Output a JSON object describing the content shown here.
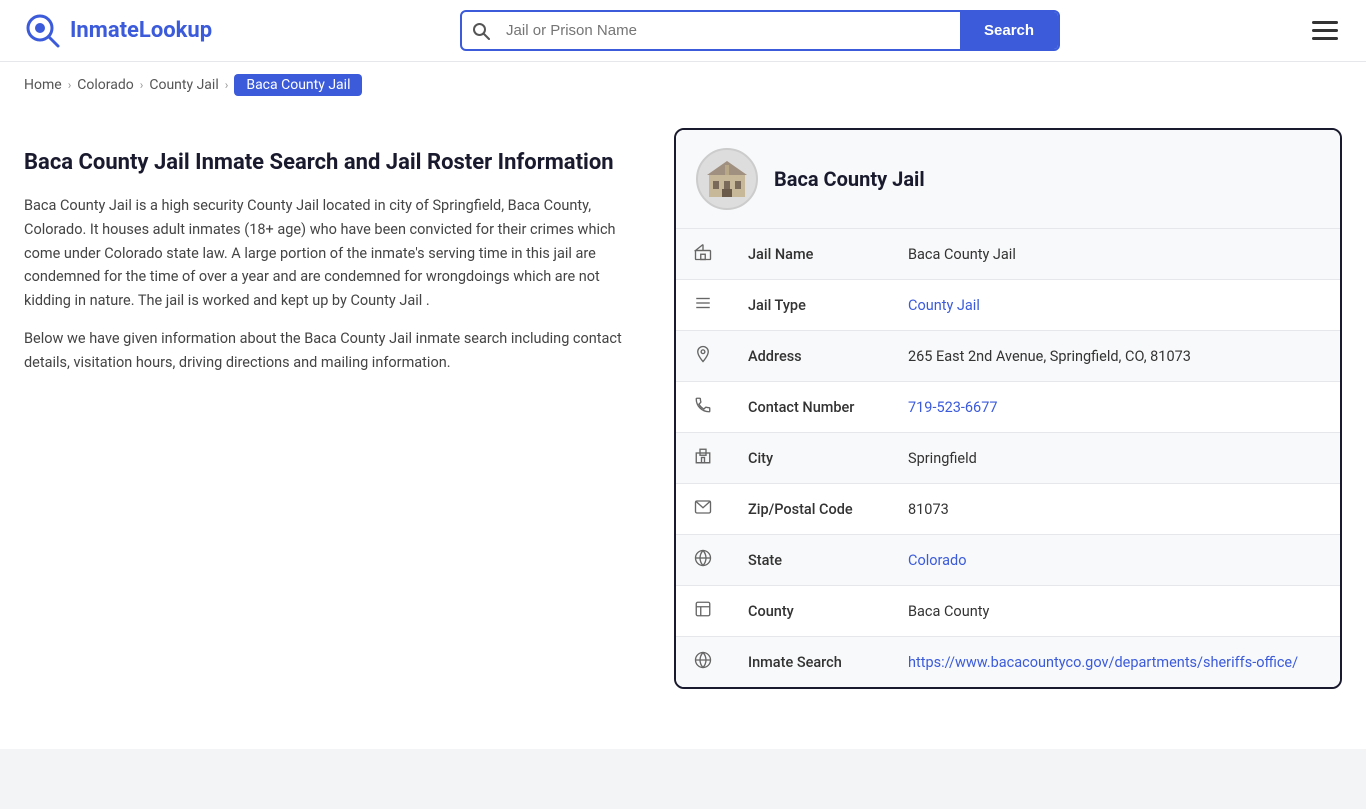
{
  "header": {
    "logo_text_part1": "Inmate",
    "logo_text_part2": "Lookup",
    "search_placeholder": "Jail or Prison Name",
    "search_button_label": "Search"
  },
  "breadcrumb": {
    "home": "Home",
    "level2": "Colorado",
    "level3": "County Jail",
    "current": "Baca County Jail"
  },
  "left": {
    "heading": "Baca County Jail Inmate Search and Jail Roster Information",
    "paragraph1": "Baca County Jail is a high security County Jail located in city of Springfield, Baca County, Colorado. It houses adult inmates (18+ age) who have been convicted for their crimes which come under Colorado state law. A large portion of the inmate's serving time in this jail are condemned for the time of over a year and are condemned for wrongdoings which are not kidding in nature. The jail is worked and kept up by County Jail .",
    "paragraph2": "Below we have given information about the Baca County Jail inmate search including contact details, visitation hours, driving directions and mailing information."
  },
  "jail_card": {
    "title": "Baca County Jail",
    "rows": [
      {
        "icon": "jail-icon",
        "label": "Jail Name",
        "value": "Baca County Jail",
        "link": false
      },
      {
        "icon": "list-icon",
        "label": "Jail Type",
        "value": "County Jail",
        "link": true,
        "href": "#"
      },
      {
        "icon": "location-icon",
        "label": "Address",
        "value": "265 East 2nd Avenue, Springfield, CO, 81073",
        "link": false
      },
      {
        "icon": "phone-icon",
        "label": "Contact Number",
        "value": "719-523-6677",
        "link": true,
        "href": "tel:7195236677"
      },
      {
        "icon": "city-icon",
        "label": "City",
        "value": "Springfield",
        "link": false
      },
      {
        "icon": "zip-icon",
        "label": "Zip/Postal Code",
        "value": "81073",
        "link": false
      },
      {
        "icon": "state-icon",
        "label": "State",
        "value": "Colorado",
        "link": true,
        "href": "#"
      },
      {
        "icon": "county-icon",
        "label": "County",
        "value": "Baca County",
        "link": false
      },
      {
        "icon": "globe-icon",
        "label": "Inmate Search",
        "value": "https://www.bacacountyco.gov/departments/sheriffs-office/",
        "link": true,
        "href": "https://www.bacacountyco.gov/departments/sheriffs-office/"
      }
    ]
  }
}
